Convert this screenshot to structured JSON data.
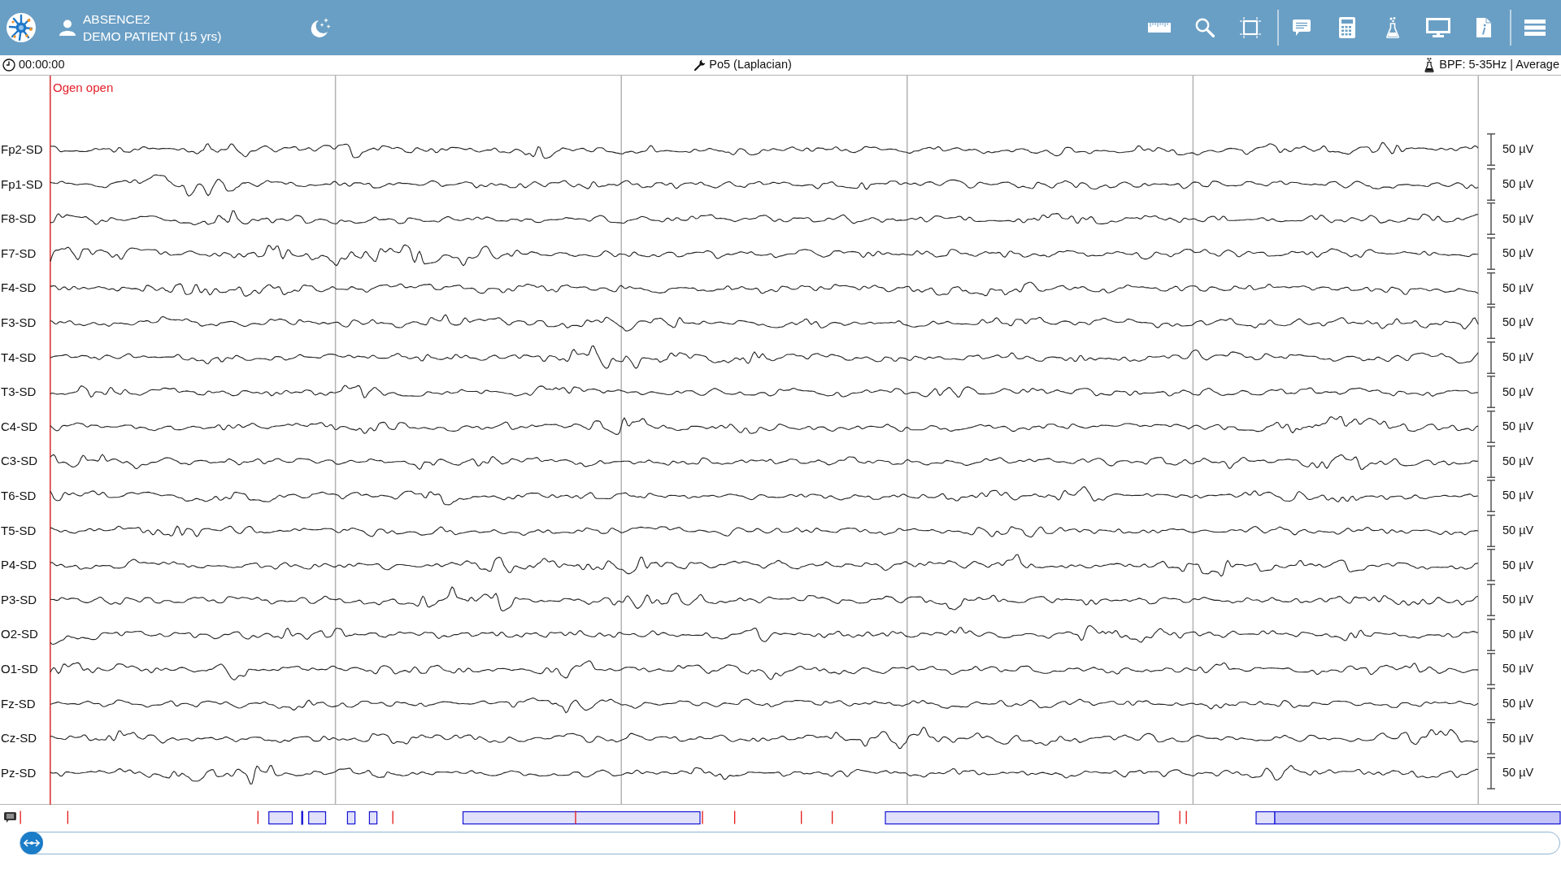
{
  "header": {
    "recording": "ABSENCE2",
    "patient": "DEMO PATIENT (15 yrs)"
  },
  "info_bar": {
    "time": "00:00:00",
    "montage": "Po5 (Laplacian)",
    "filter": "BPF: 5-35Hz | Average"
  },
  "marker": {
    "label": "Ogen open"
  },
  "channels": [
    {
      "name": "Fp2-SD",
      "scale": "50 µV"
    },
    {
      "name": "Fp1-SD",
      "scale": "50 µV"
    },
    {
      "name": "F8-SD",
      "scale": "50 µV"
    },
    {
      "name": "F7-SD",
      "scale": "50 µV"
    },
    {
      "name": "F4-SD",
      "scale": "50 µV"
    },
    {
      "name": "F3-SD",
      "scale": "50 µV"
    },
    {
      "name": "T4-SD",
      "scale": "50 µV"
    },
    {
      "name": "T3-SD",
      "scale": "50 µV"
    },
    {
      "name": "C4-SD",
      "scale": "50 µV"
    },
    {
      "name": "C3-SD",
      "scale": "50 µV"
    },
    {
      "name": "T6-SD",
      "scale": "50 µV"
    },
    {
      "name": "T5-SD",
      "scale": "50 µV"
    },
    {
      "name": "P4-SD",
      "scale": "50 µV"
    },
    {
      "name": "P3-SD",
      "scale": "50 µV"
    },
    {
      "name": "O2-SD",
      "scale": "50 µV"
    },
    {
      "name": "O1-SD",
      "scale": "50 µV"
    },
    {
      "name": "Fz-SD",
      "scale": "50 µV"
    },
    {
      "name": "Cz-SD",
      "scale": "50 µV"
    },
    {
      "name": "Pz-SD",
      "scale": "50 µV"
    }
  ],
  "navigator": {
    "level": 0
  }
}
